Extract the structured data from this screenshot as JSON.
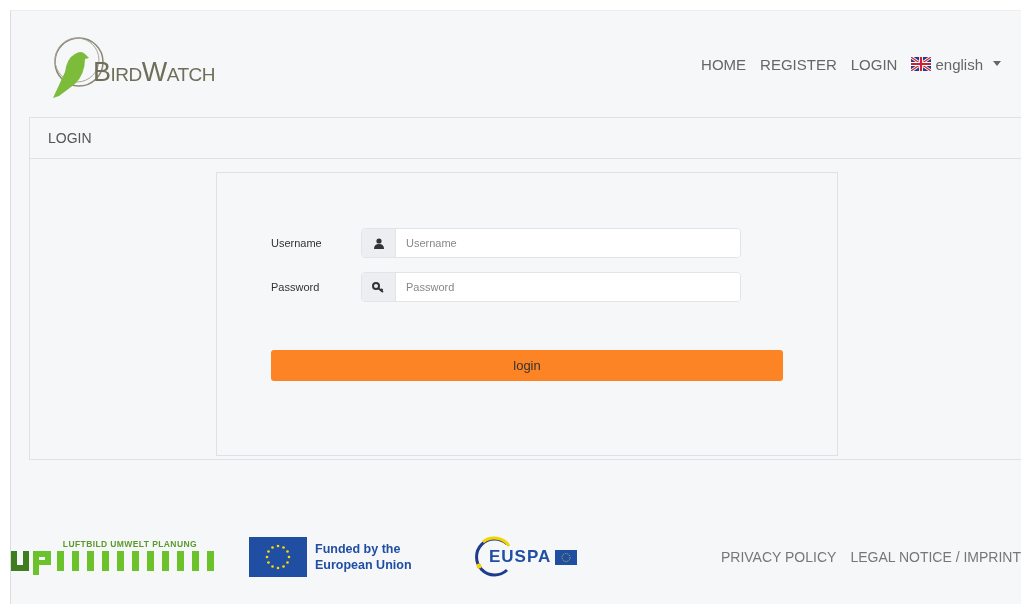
{
  "logo": {
    "text": "BirdWatch"
  },
  "nav": [
    {
      "label": "HOME"
    },
    {
      "label": "REGISTER"
    },
    {
      "label": "LOGIN"
    }
  ],
  "language": {
    "label": "english"
  },
  "panel": {
    "title": "LOGIN"
  },
  "form": {
    "fields": [
      {
        "label": "Username",
        "placeholder": "Username",
        "kind": "user"
      },
      {
        "label": "Password",
        "placeholder": "Password",
        "kind": "key"
      }
    ],
    "submit": "login"
  },
  "footer": {
    "partner": "LUFTBILD UMWELT PLANUNG",
    "eu_funding": "Funded by the European Union",
    "agency": "EUSPA",
    "links": [
      {
        "label": "PRIVACY POLICY"
      },
      {
        "label": "LEGAL NOTICE / IMPRINT"
      }
    ]
  }
}
